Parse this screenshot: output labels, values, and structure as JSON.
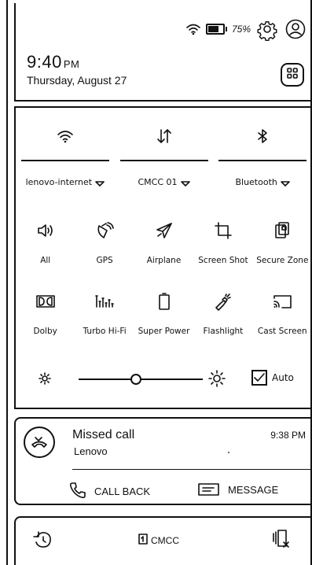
{
  "status_bar": {
    "battery_text": "75%",
    "battery_level": 0.75,
    "wifi_icon": "wifi-icon",
    "settings_icon": "gear-icon",
    "profile_icon": "user-icon"
  },
  "header": {
    "time": "9:40",
    "ampm": "PM",
    "date": "Thursday, August 27",
    "apps_icon": "apps-grid-icon"
  },
  "connectivity": [
    {
      "icon": "wifi-icon",
      "label": "lenovo-internet"
    },
    {
      "icon": "data-arrows-icon",
      "label": "CMCC 01"
    },
    {
      "icon": "bluetooth-icon",
      "label": "Bluetooth"
    }
  ],
  "tiles": {
    "row1": [
      {
        "icon": "speaker-icon",
        "label": "All"
      },
      {
        "icon": "gps-icon",
        "label": "GPS"
      },
      {
        "icon": "airplane-icon",
        "label": "Airplane"
      },
      {
        "icon": "crop-icon",
        "label": "Screen Shot"
      },
      {
        "icon": "secure-zone-icon",
        "label": "Secure Zone"
      }
    ],
    "row2": [
      {
        "icon": "dolby-icon",
        "label": "Dolby"
      },
      {
        "icon": "equalizer-icon",
        "label": "Turbo Hi-Fi"
      },
      {
        "icon": "battery-icon",
        "label": "Super Power"
      },
      {
        "icon": "flashlight-icon",
        "label": "Flashlight"
      },
      {
        "icon": "cast-icon",
        "label": "Cast Screen"
      }
    ]
  },
  "brightness": {
    "level": 0.46,
    "auto_label": "Auto",
    "auto_checked": true
  },
  "notification": {
    "title": "Missed call",
    "subtitle": "Lenovo",
    "time": "9:38 PM",
    "action_callback": "CALL BACK",
    "action_message": "MESSAGE"
  },
  "bottom_bar": {
    "carrier": "CMCC"
  }
}
